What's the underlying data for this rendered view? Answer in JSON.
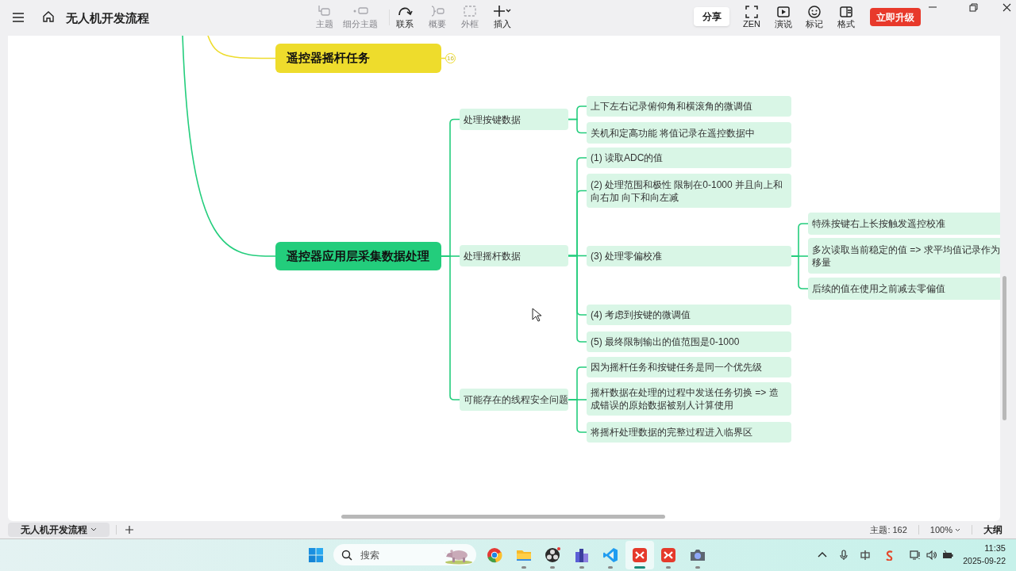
{
  "window": {
    "title": "无人机开发流程"
  },
  "toolbar": {
    "tools": [
      {
        "label": "主题",
        "kind": "topic",
        "disabled": true
      },
      {
        "label": "细分主题",
        "kind": "subtopic",
        "disabled": true
      },
      {
        "label": "联系",
        "kind": "relation",
        "disabled": false
      },
      {
        "label": "概要",
        "kind": "summary",
        "disabled": true
      },
      {
        "label": "外框",
        "kind": "boundary",
        "disabled": true
      },
      {
        "label": "插入",
        "kind": "insert",
        "disabled": false
      }
    ],
    "share": "分享",
    "view_tools": [
      {
        "label": "ZEN",
        "kind": "zen"
      },
      {
        "label": "演说",
        "kind": "pitch"
      },
      {
        "label": "标记",
        "kind": "marker"
      },
      {
        "label": "格式",
        "kind": "format"
      }
    ],
    "upgrade": "立即升级"
  },
  "mindmap": {
    "topics": [
      {
        "text": "遥控器摇杆任务",
        "color": "#eedc2c",
        "badge": "16"
      },
      {
        "text": "遥控器应用层采集数据处理",
        "color": "#23cd7c",
        "children": [
          {
            "text": "处理按键数据",
            "children": [
              {
                "text": "上下左右记录俯仰角和横滚角的微调值"
              },
              {
                "text": "关机和定高功能  将值记录在遥控数据中"
              }
            ]
          },
          {
            "text": "处理摇杆数据",
            "children": [
              {
                "text": "(1) 读取ADC的值"
              },
              {
                "text": "(2) 处理范围和极性  限制在0-1000 并且向上和向右加  向下和向左减"
              },
              {
                "text": "(3) 处理零偏校准",
                "children": [
                  {
                    "text": "特殊按键右上长按触发遥控校准"
                  },
                  {
                    "text": "多次读取当前稳定的值 => 求平均值记录作为移量"
                  },
                  {
                    "text": "后续的值在使用之前减去零偏值"
                  }
                ]
              },
              {
                "text": "(4) 考虑到按键的微调值"
              },
              {
                "text": "(5) 最终限制输出的值范围是0-1000"
              }
            ]
          },
          {
            "text": "可能存在的线程安全问题",
            "children": [
              {
                "text": "因为摇杆任务和按键任务是同一个优先级"
              },
              {
                "text": "摇杆数据在处理的过程中发送任务切换 => 造成错误的原始数据被别人计算使用"
              },
              {
                "text": "将摇杆处理数据的完整过程进入临界区"
              }
            ]
          }
        ]
      }
    ]
  },
  "sheet_tabs": [
    {
      "label": "无人机开发流程",
      "selected": true
    }
  ],
  "status": {
    "topic_count": "主题: 162",
    "zoom": "100%",
    "outline": "大纲"
  },
  "taskbar": {
    "search_placeholder": "搜索",
    "apps": [
      {
        "kind": "chrome",
        "running": false,
        "selected": false
      },
      {
        "kind": "folder",
        "running": true,
        "selected": false
      },
      {
        "kind": "obs",
        "running": true,
        "selected": false
      },
      {
        "kind": "buildings",
        "running": true,
        "selected": false
      },
      {
        "kind": "vscode",
        "running": true,
        "selected": false
      },
      {
        "kind": "xmind",
        "running": true,
        "selected": true
      },
      {
        "kind": "xmind",
        "running": true,
        "selected": false
      },
      {
        "kind": "camera",
        "running": true,
        "selected": false
      }
    ],
    "time": "11:35",
    "date": "2025-09-22"
  }
}
